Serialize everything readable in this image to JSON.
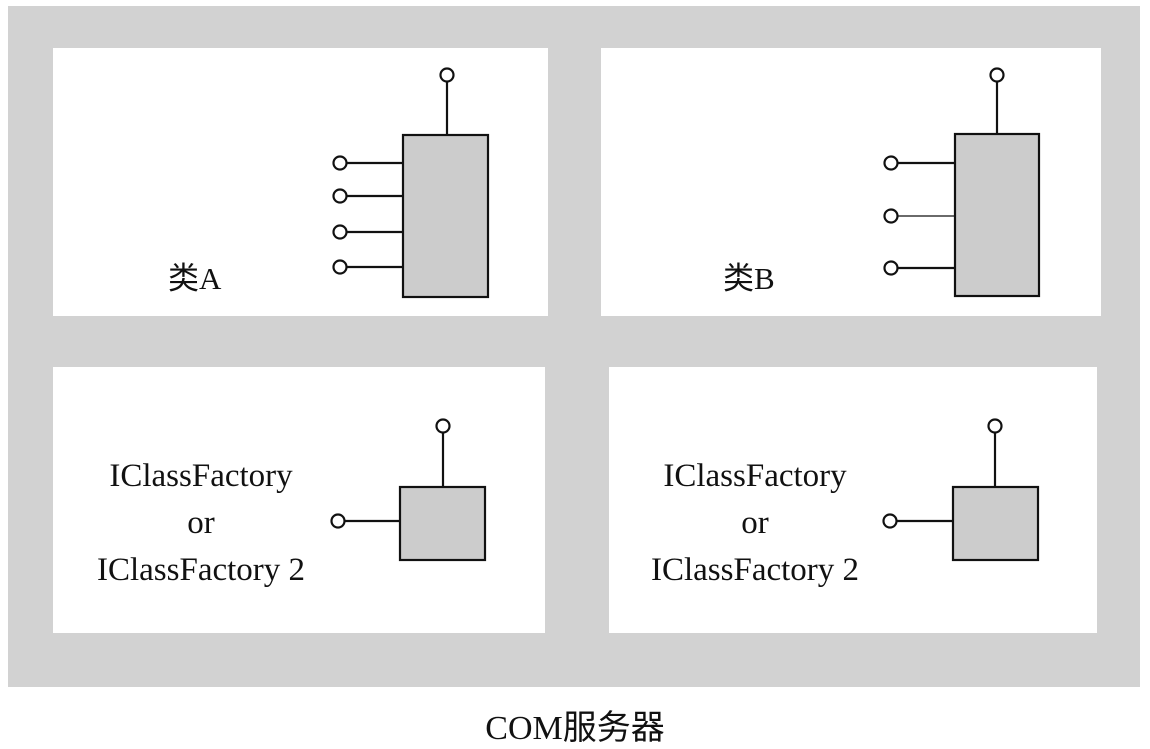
{
  "server": {
    "caption": "COM服务器"
  },
  "class_a": {
    "label": "类A",
    "side_interfaces": 4
  },
  "class_b": {
    "label": "类B",
    "side_interfaces": 3
  },
  "factory_left": {
    "line1": "IClassFactory",
    "line2": "or",
    "line3": "IClassFactory 2"
  },
  "factory_right": {
    "line1": "IClassFactory",
    "line2": "or",
    "line3": "IClassFactory 2"
  },
  "colors": {
    "server_bg": "#d2d2d2",
    "panel_bg": "#ffffff",
    "box_fill": "#cccccc",
    "stroke": "#111111"
  }
}
